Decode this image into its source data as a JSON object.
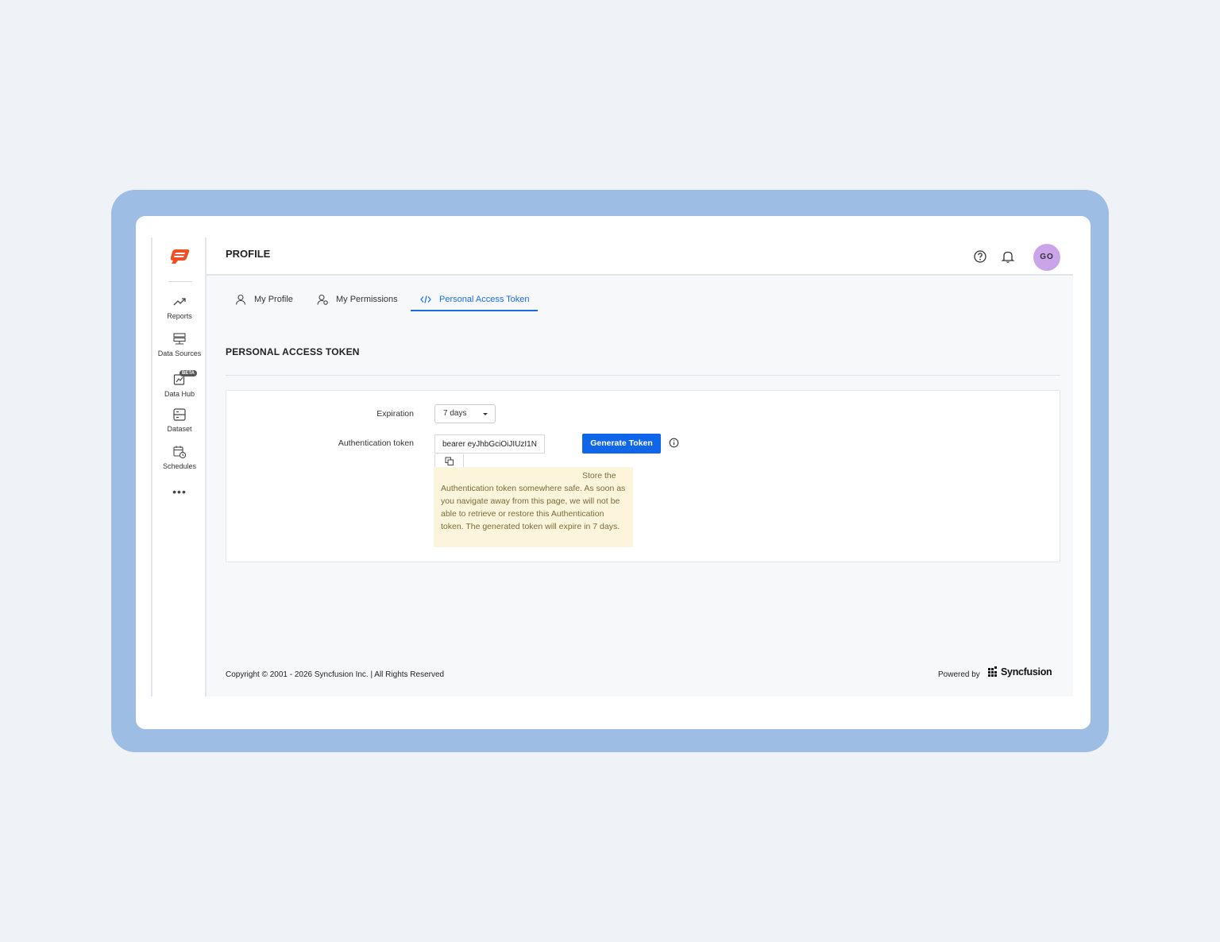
{
  "sidebar": {
    "items": [
      {
        "label": "Reports",
        "icon": "trending-up-icon"
      },
      {
        "label": "Data Sources",
        "icon": "database-server-icon"
      },
      {
        "label": "Data Hub",
        "icon": "data-hub-icon",
        "badge": "BETA"
      },
      {
        "label": "Dataset",
        "icon": "dataset-icon"
      },
      {
        "label": "Schedules",
        "icon": "calendar-clock-icon"
      }
    ],
    "more": "•••"
  },
  "header": {
    "title": "PROFILE",
    "avatar_initials": "GO",
    "avatar_color": "#c9a4e8"
  },
  "tabs": [
    {
      "label": "My Profile",
      "icon": "user-icon",
      "active": false
    },
    {
      "label": "My Permissions",
      "icon": "user-permissions-icon",
      "active": false
    },
    {
      "label": "Personal Access Token",
      "icon": "code-icon",
      "active": true
    }
  ],
  "section": {
    "title": "PERSONAL ACCESS TOKEN"
  },
  "form": {
    "expiration_label": "Expiration",
    "expiration_value": "7 days",
    "token_label": "Authentication token",
    "token_value": "bearer eyJhbGciOiJIUzI1N",
    "generate_button": "Generate Token",
    "warning_first": "Store the",
    "warning_rest": "Authentication token somewhere safe. As soon as you navigate away from this page, we will not be able to retrieve or restore this Authentication token. The generated token will expire in 7 days."
  },
  "footer": {
    "copyright": "Copyright © 2001 - 2026 Syncfusion Inc.   |   All Rights Reserved",
    "powered_by": "Powered by",
    "brand": "Syncfusion"
  },
  "colors": {
    "accent": "#1066e8",
    "frame": "#9dbde5",
    "warning_bg": "#fdf4dc",
    "logo": "#f04e23"
  }
}
